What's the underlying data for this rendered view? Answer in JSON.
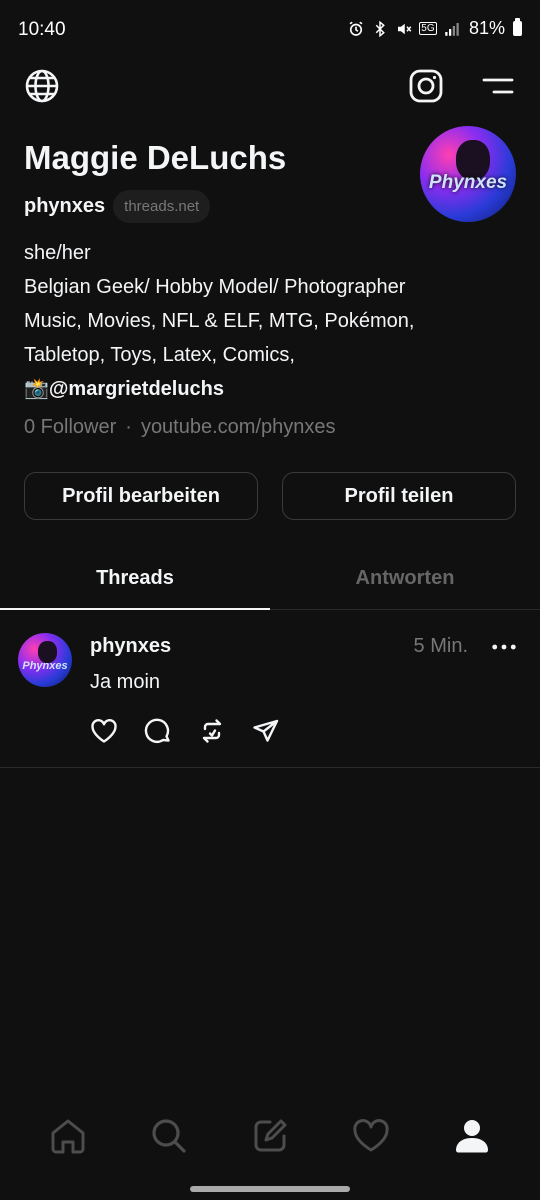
{
  "status_bar": {
    "time": "10:40",
    "network": "5G",
    "battery": "81%",
    "icons": [
      "alarm-icon",
      "bluetooth-icon",
      "mute-icon",
      "5g-icon",
      "signal-icon",
      "battery-icon"
    ]
  },
  "top_bar": {
    "left_icon": "globe-icon",
    "right_icons": [
      "instagram-icon",
      "menu-icon"
    ]
  },
  "profile": {
    "name": "Maggie DeLuchs",
    "handle": "phynxes",
    "domain_badge": "threads.net",
    "avatar_text": "Phynxes",
    "bio": {
      "line1": "she/her",
      "line2": "Belgian Geek/ Hobby Model/ Photographer",
      "line3": "Music, Movies, NFL & ELF, MTG, Pokémon,",
      "line4": "Tabletop, Toys, Latex, Comics,",
      "line5_emoji": "📸",
      "line5_mention": "@margrietdeluchs"
    },
    "followers": "0 Follower",
    "separator": "·",
    "link": "youtube.com/phynxes"
  },
  "buttons": {
    "edit_profile": "Profil bearbeiten",
    "share_profile": "Profil teilen"
  },
  "tabs": [
    {
      "label": "Threads",
      "active": true
    },
    {
      "label": "Antworten",
      "active": false
    }
  ],
  "post": {
    "username": "phynxes",
    "time": "5 Min.",
    "text": "Ja moin",
    "avatar_text": "Phynxes",
    "actions": [
      "heart-icon",
      "comment-icon",
      "repost-icon",
      "share-icon"
    ]
  },
  "bottom_nav": {
    "items": [
      "home-icon",
      "search-icon",
      "compose-icon",
      "activity-icon",
      "profile-icon"
    ],
    "active": "profile-icon"
  },
  "colors": {
    "background": "#101010",
    "text_primary": "#f3f5f7",
    "text_secondary": "#777777",
    "border": "#3a3a3a"
  }
}
